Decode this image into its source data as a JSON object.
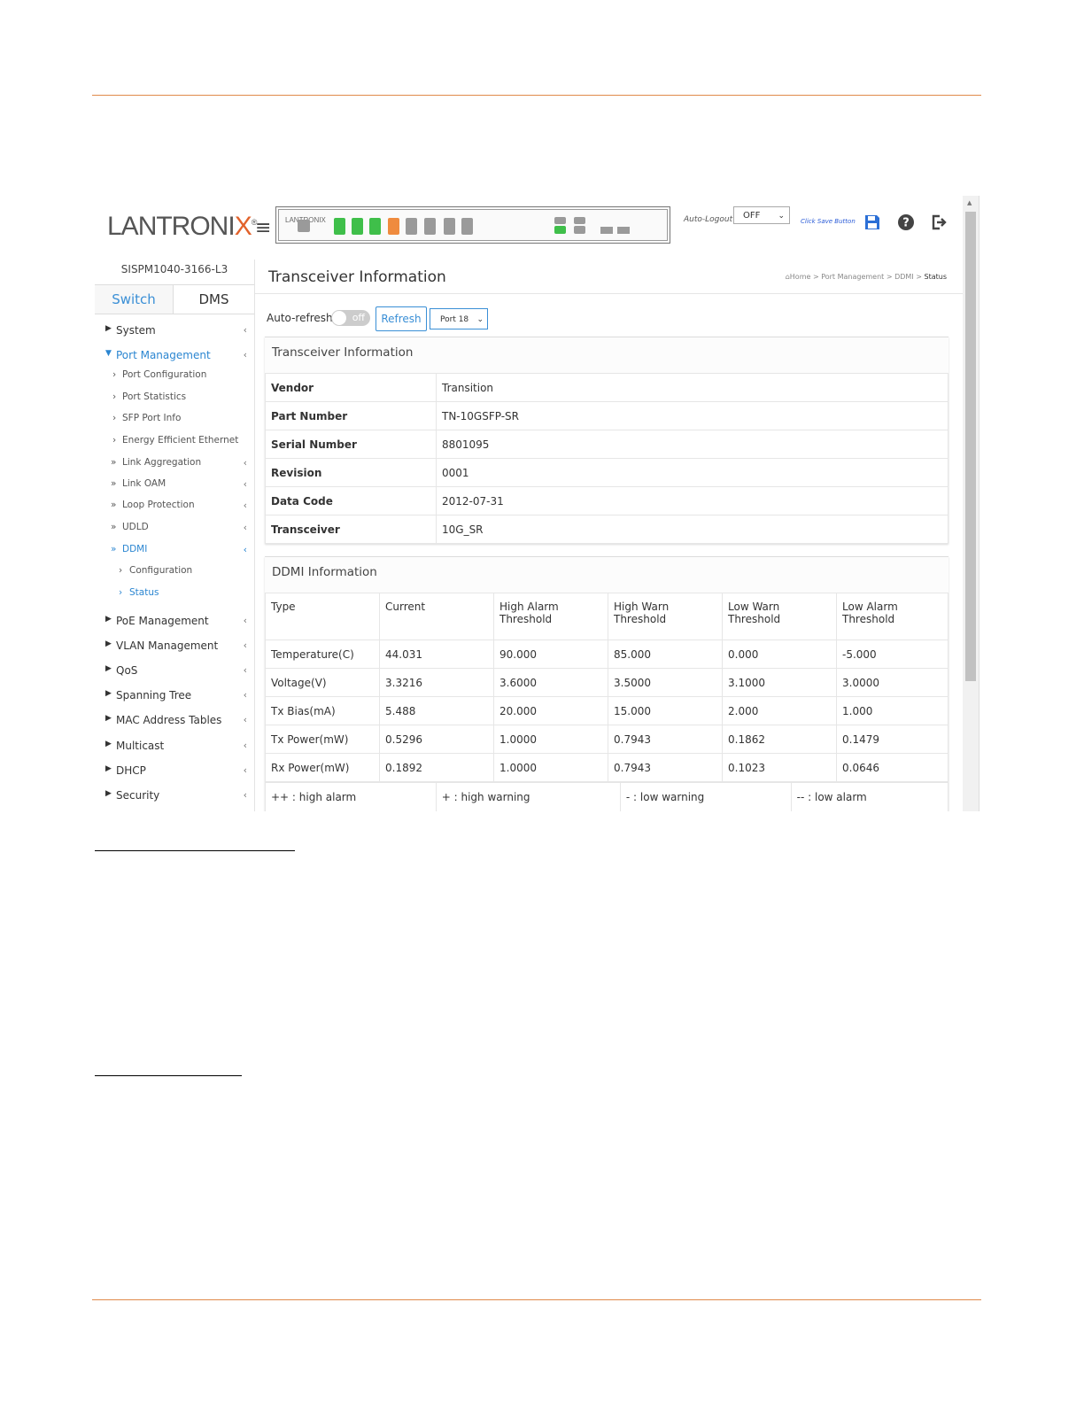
{
  "header": {
    "logo_main": "LANTRONI",
    "logo_x": "X",
    "logo_reg": "®",
    "hamburger": "≡",
    "panel_brand": "LANTRONIX",
    "auto_logout_label": "Auto-Logout",
    "auto_logout_value": "OFF",
    "click_save": "Click Save Button",
    "icons": [
      "save-icon",
      "help-icon",
      "logout-icon"
    ]
  },
  "sidebar": {
    "model": "SISPM1040-3166-L3",
    "tabs": [
      "Switch",
      "DMS"
    ],
    "items": [
      {
        "label": "System"
      },
      {
        "label": "Port Management"
      },
      {
        "label": "Port Configuration"
      },
      {
        "label": "Port Statistics"
      },
      {
        "label": "SFP Port Info"
      },
      {
        "label": "Energy Efficient Ethernet"
      },
      {
        "label": "Link Aggregation"
      },
      {
        "label": "Link OAM"
      },
      {
        "label": "Loop Protection"
      },
      {
        "label": "UDLD"
      },
      {
        "label": "DDMI"
      },
      {
        "label": "Configuration"
      },
      {
        "label": "Status"
      },
      {
        "label": "PoE Management"
      },
      {
        "label": "VLAN Management"
      },
      {
        "label": "QoS"
      },
      {
        "label": "Spanning Tree"
      },
      {
        "label": "MAC Address Tables"
      },
      {
        "label": "Multicast"
      },
      {
        "label": "DHCP"
      },
      {
        "label": "Security"
      }
    ]
  },
  "main": {
    "title": "Transceiver Information",
    "breadcrumb": [
      "Home",
      "Port Management",
      "DDMI",
      "Status"
    ],
    "auto_refresh_label": "Auto-refresh",
    "toggle_text": "off",
    "refresh_label": "Refresh",
    "port_select": "Port 18",
    "transceiver": {
      "header": "Transceiver Information",
      "rows": [
        {
          "key": "Vendor",
          "value": "Transition"
        },
        {
          "key": "Part Number",
          "value": "TN-10GSFP-SR"
        },
        {
          "key": "Serial Number",
          "value": "8801095"
        },
        {
          "key": "Revision",
          "value": "0001"
        },
        {
          "key": "Data Code",
          "value": "2012-07-31"
        },
        {
          "key": "Transceiver",
          "value": "10G_SR"
        }
      ]
    },
    "ddmi": {
      "header": "DDMI Information",
      "columns": [
        "Type",
        "Current",
        "High Alarm\nThreshold",
        "High Warn\nThreshold",
        "Low Warn\nThreshold",
        "Low Alarm\nThreshold"
      ],
      "rows": [
        [
          "Temperature(C)",
          "44.031",
          "90.000",
          "85.000",
          "0.000",
          "-5.000"
        ],
        [
          "Voltage(V)",
          "3.3216",
          "3.6000",
          "3.5000",
          "3.1000",
          "3.0000"
        ],
        [
          "Tx Bias(mA)",
          "5.488",
          "20.000",
          "15.000",
          "2.000",
          "1.000"
        ],
        [
          "Tx Power(mW)",
          "0.5296",
          "1.0000",
          "0.7943",
          "0.1862",
          "0.1479"
        ],
        [
          "Rx Power(mW)",
          "0.1892",
          "1.0000",
          "0.7943",
          "0.1023",
          "0.0646"
        ]
      ],
      "legend": [
        "++ : high alarm",
        "+ : high warning",
        "- : low warning",
        "-- : low alarm"
      ]
    }
  }
}
